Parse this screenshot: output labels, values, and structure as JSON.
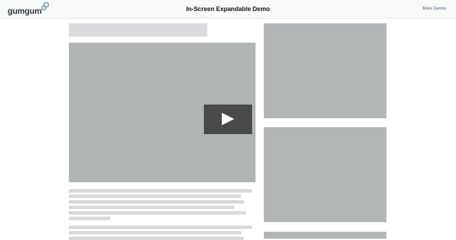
{
  "header": {
    "logo_text": "gumgum",
    "title": "In-Screen Expandable Demo",
    "more_demos_label": "More Demos"
  },
  "colors": {
    "header_bg": "#f8f9f9",
    "placeholder_dark": "#b1b5b6",
    "placeholder_light": "#d9dbdc",
    "play_button": "#484a4b",
    "link": "#2e5c7d"
  },
  "icons": {
    "play": "play-icon",
    "logo_mark": "gumgum-logo-mark"
  }
}
